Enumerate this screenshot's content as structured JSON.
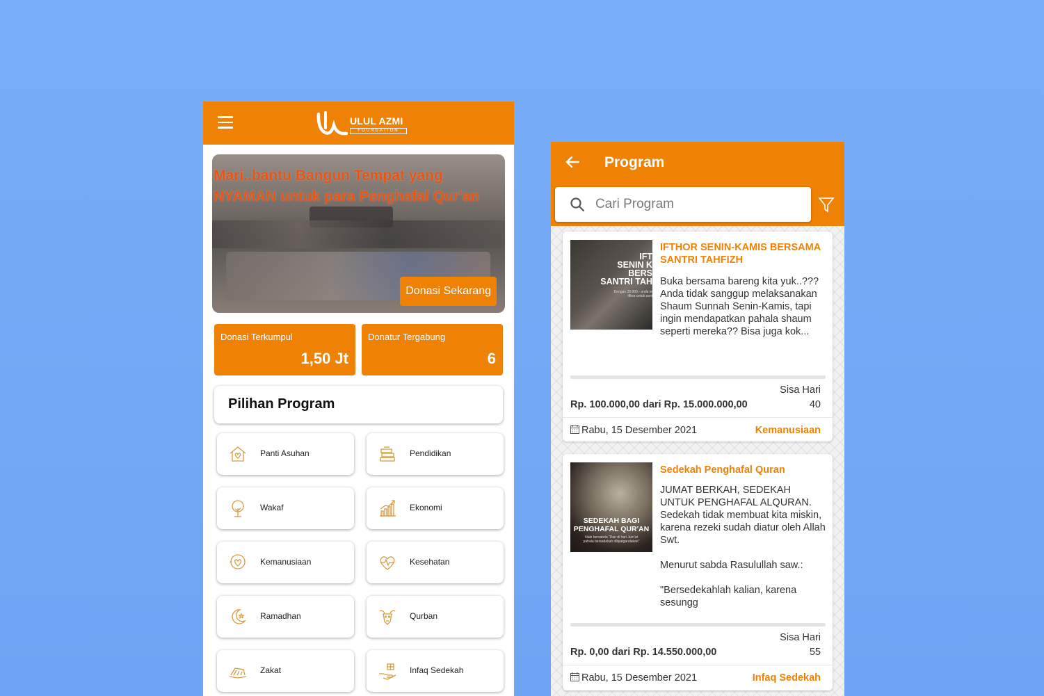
{
  "colors": {
    "accent": "#ef8205",
    "background": "#78aef8"
  },
  "left_app": {
    "logo": {
      "text": "ULUL AZMI",
      "sub": "FOUNDATION"
    },
    "banner": {
      "title": "Mari..bantu Bangun Tempat yang NYAMAN untuk para Penghafal Qur'an",
      "cta": "Donasi Sekarang"
    },
    "stats": [
      {
        "label": "Donasi Terkumpul",
        "value": "1,50 Jt"
      },
      {
        "label": "Donatur Tergabung",
        "value": "6"
      }
    ],
    "section_title": "Pilihan Program",
    "categories": [
      {
        "label": "Panti Asuhan",
        "icon": "house-heart-icon"
      },
      {
        "label": "Pendidikan",
        "icon": "books-icon"
      },
      {
        "label": "Wakaf",
        "icon": "tree-icon"
      },
      {
        "label": "Ekonomi",
        "icon": "chart-growth-icon"
      },
      {
        "label": "Kemanusiaan",
        "icon": "heart-hands-icon"
      },
      {
        "label": "Kesehatan",
        "icon": "heartbeat-icon"
      },
      {
        "label": "Ramadhan",
        "icon": "crescent-star-icon"
      },
      {
        "label": "Qurban",
        "icon": "goat-icon"
      },
      {
        "label": "Zakat",
        "icon": "coins-icon"
      },
      {
        "label": "Infaq Sedekah",
        "icon": "giving-hand-icon"
      }
    ]
  },
  "right_app": {
    "title": "Program",
    "search": {
      "placeholder": "Cari Program"
    },
    "programs": [
      {
        "title": "IFTHOR SENIN-KAMIS BERSAMA SANTRI TAHFIZH",
        "description": "Buka bersama bareng kita yuk..???\nAnda tidak sanggup melaksanakan Shaum Sunnah Senin-Kamis, tapi ingin mendapatkan pahala shaum seperti mereka?? Bisa juga kok...",
        "thumb_text": "IFT\nSENIN K\nBERS\nSANTRI TAH",
        "thumb_small": "Dengan 25.000,- anda te\nifthor untuk sant",
        "sisa_label": "Sisa Hari",
        "amount": "Rp. 100.000,00 dari Rp. 15.000.000,00",
        "sisa_value": "40",
        "date": "Rabu, 15 Desember 2021",
        "category": "Kemanusiaan"
      },
      {
        "title": "Sedekah Penghafal Quran",
        "description": "JUMAT BERKAH, SEDEKAH UNTUK PENGHAFAL ALQURAN.\nSedekah tidak membuat kita miskin, karena rezeki sudah diatur oleh Allah Swt.\n\nMenurut sabda Rasulullah saw.:\n\n\"Bersedekahlah kalian, karena sesungg",
        "thumb_text": "SEDEKAH BAGI\nPENGHAFAL QUR'AN",
        "thumb_small": "Nabi bersabda \"Dan di hari Jum'at\npahala bersedekah dilipatgandakan\"",
        "sisa_label": "Sisa Hari",
        "amount": "Rp. 0,00 dari Rp. 14.550.000,00",
        "sisa_value": "55",
        "date": "Rabu, 15 Desember 2021",
        "category": "Infaq Sedekah"
      }
    ]
  }
}
